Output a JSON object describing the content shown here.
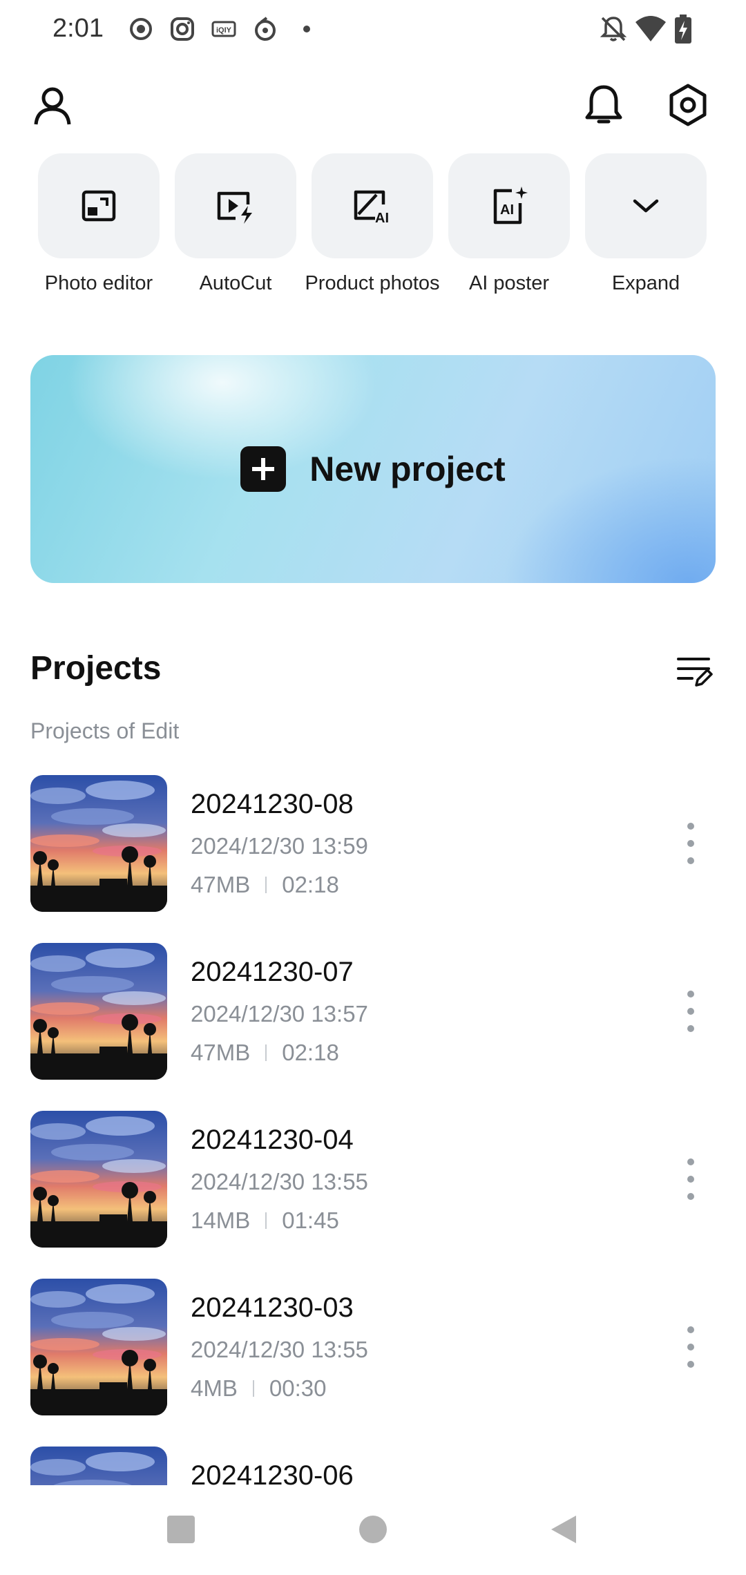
{
  "status_bar": {
    "time": "2:01",
    "left_icons": [
      "record-icon",
      "instagram-icon",
      "iqiyi-icon",
      "netease-music-icon",
      "dot-icon"
    ],
    "right_icons": [
      "bell-off-icon",
      "wifi-icon",
      "battery-charging-icon"
    ]
  },
  "header": {
    "profile_icon": "person-icon",
    "notification_icon": "bell-icon",
    "settings_icon": "hexagon-settings-icon"
  },
  "tools": [
    {
      "label": "Photo editor",
      "icon": "photo-editor-icon"
    },
    {
      "label": "AutoCut",
      "icon": "autocut-icon"
    },
    {
      "label": "Product photos",
      "icon": "product-photos-icon"
    },
    {
      "label": "AI poster",
      "icon": "ai-poster-icon"
    },
    {
      "label": "Expand",
      "icon": "chevron-down-icon"
    }
  ],
  "new_project": {
    "label": "New project",
    "icon": "plus-icon"
  },
  "projects": {
    "title": "Projects",
    "subtitle": "Projects of Edit",
    "items": [
      {
        "name": "20241230-08",
        "date": "2024/12/30 13:59",
        "size": "47MB",
        "duration": "02:18"
      },
      {
        "name": "20241230-07",
        "date": "2024/12/30 13:57",
        "size": "47MB",
        "duration": "02:18"
      },
      {
        "name": "20241230-04",
        "date": "2024/12/30 13:55",
        "size": "14MB",
        "duration": "01:45"
      },
      {
        "name": "20241230-03",
        "date": "2024/12/30 13:55",
        "size": "4MB",
        "duration": "00:30"
      },
      {
        "name": "20241230-06",
        "date": "",
        "size": "",
        "duration": ""
      }
    ]
  },
  "colors": {
    "accent_dark": "#111111",
    "muted_text": "#8a8f96",
    "tool_bg": "#f0f2f4"
  }
}
